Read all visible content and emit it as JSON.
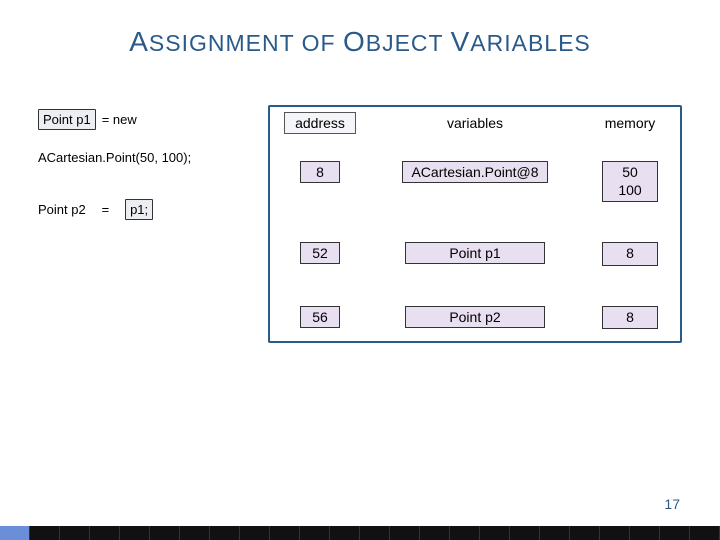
{
  "title_parts": {
    "w1a": "A",
    "w1b": "SSIGNMENT",
    "w2": "OF",
    "w3a": "O",
    "w3b": "BJECT",
    "w4a": "V",
    "w4b": "ARIABLES"
  },
  "code": {
    "l1a": "Point p1",
    "l1b": "= new",
    "l2": "ACartesian.Point(50, 100);",
    "l3a": "Point p2",
    "l3b": "=",
    "l3c": "p1;"
  },
  "table": {
    "headers": {
      "address": "address",
      "variables": "variables",
      "memory": "memory"
    },
    "rows": [
      {
        "address": "8",
        "variable": "ACartesian.Point@8",
        "memory": "50\n100"
      },
      {
        "address": "52",
        "variable": "Point p1",
        "memory": "8"
      },
      {
        "address": "56",
        "variable": "Point p2",
        "memory": "8"
      }
    ]
  },
  "page_number": "17"
}
